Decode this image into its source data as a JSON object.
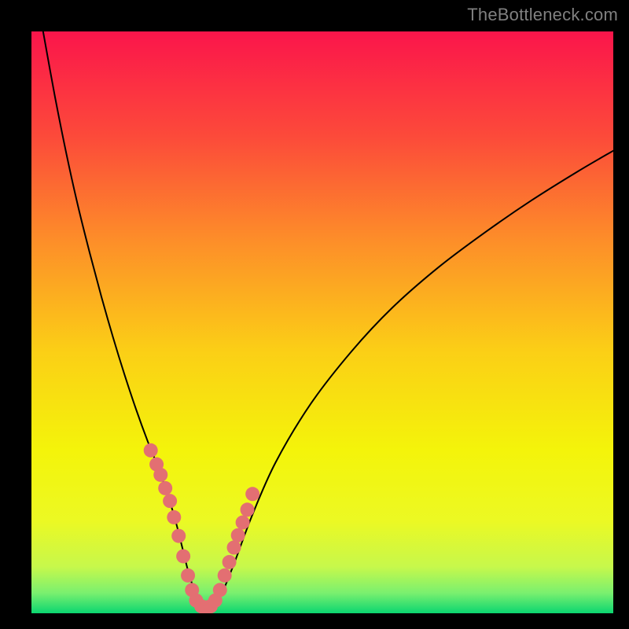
{
  "watermark": "TheBottleneck.com",
  "chart_data": {
    "type": "line",
    "title": "",
    "xlabel": "",
    "ylabel": "",
    "xlim": [
      0,
      100
    ],
    "ylim": [
      0,
      100
    ],
    "grid": false,
    "legend": false,
    "background_gradient_stops": [
      {
        "offset": 0.0,
        "color": "#fb154b"
      },
      {
        "offset": 0.18,
        "color": "#fc4a3a"
      },
      {
        "offset": 0.36,
        "color": "#fd8e29"
      },
      {
        "offset": 0.55,
        "color": "#fbcf16"
      },
      {
        "offset": 0.72,
        "color": "#f4f40a"
      },
      {
        "offset": 0.84,
        "color": "#ecf923"
      },
      {
        "offset": 0.92,
        "color": "#c7f84b"
      },
      {
        "offset": 0.965,
        "color": "#7af06f"
      },
      {
        "offset": 1.0,
        "color": "#0bd670"
      }
    ],
    "series": [
      {
        "name": "bottleneck-curve",
        "color": "#000000",
        "stroke_width": 2,
        "x": [
          2,
          4,
          6,
          8,
          10,
          12,
          14,
          16,
          18,
          20,
          22,
          24,
          25,
          26,
          27,
          28,
          29,
          30,
          31,
          32,
          33,
          35,
          38,
          42,
          48,
          55,
          62,
          70,
          78,
          86,
          94,
          100
        ],
        "y": [
          100,
          89,
          79,
          70,
          62,
          54.5,
          47.5,
          41,
          35,
          29.5,
          24.5,
          18.5,
          15,
          11,
          7,
          4,
          2,
          1,
          1,
          2,
          4,
          9,
          17,
          26,
          36,
          45,
          52.5,
          59.5,
          65.5,
          71,
          76,
          79.5
        ]
      }
    ],
    "markers": {
      "name": "bottleneck-markers",
      "color": "#e36f72",
      "radius": 9,
      "x": [
        20.5,
        21.5,
        22.2,
        23.0,
        23.8,
        24.5,
        25.3,
        26.1,
        26.9,
        27.6,
        28.3,
        29.2,
        30.0,
        30.8,
        31.6,
        32.4,
        33.2,
        34.0,
        34.8,
        35.5,
        36.3,
        37.1,
        38.0
      ],
      "y": [
        28.0,
        25.6,
        23.8,
        21.5,
        19.3,
        16.5,
        13.3,
        9.8,
        6.5,
        4.0,
        2.2,
        1.2,
        1.0,
        1.2,
        2.2,
        4.0,
        6.5,
        8.8,
        11.3,
        13.4,
        15.6,
        17.8,
        20.5
      ]
    }
  }
}
